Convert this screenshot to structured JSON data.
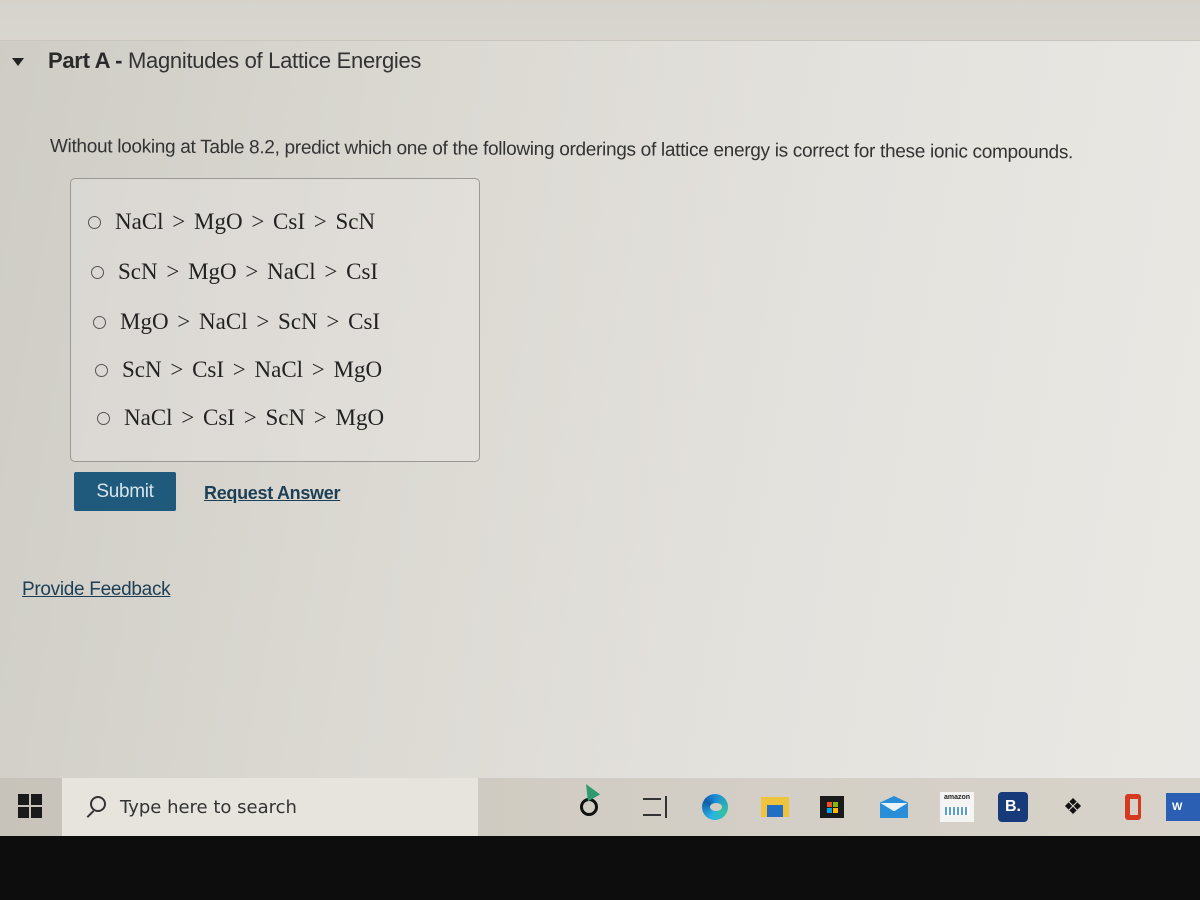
{
  "part": {
    "label": "Part A",
    "separator": " - ",
    "title": "Magnitudes of Lattice Energies"
  },
  "question": "Without looking at Table 8.2, predict which one of the following orderings of lattice energy is correct for these ionic compounds.",
  "options": [
    {
      "text": "NaCl > MgO > CsI > ScN",
      "selected": false
    },
    {
      "text": "ScN > MgO > NaCl > CsI",
      "selected": false
    },
    {
      "text": "MgO > NaCl > ScN > CsI",
      "selected": false
    },
    {
      "text": "ScN > CsI > NaCl > MgO",
      "selected": false
    },
    {
      "text": "NaCl > CsI > ScN > MgO",
      "selected": false
    }
  ],
  "actions": {
    "submit": "Submit",
    "request_answer": "Request Answer",
    "provide_feedback": "Provide Feedback"
  },
  "taskbar": {
    "search_placeholder": "Type here to search",
    "pinned": [
      "cortana",
      "task-view",
      "edge",
      "file-explorer",
      "microsoft-store",
      "mail",
      "amazon",
      "booking",
      "dropbox",
      "office",
      "word"
    ],
    "amazon_label": "amazon",
    "booking_label": "B.",
    "word_label": "W",
    "dropbox_glyph": "❖"
  },
  "colors": {
    "submit_bg": "#1f5a7c",
    "link": "#1d3f55"
  }
}
